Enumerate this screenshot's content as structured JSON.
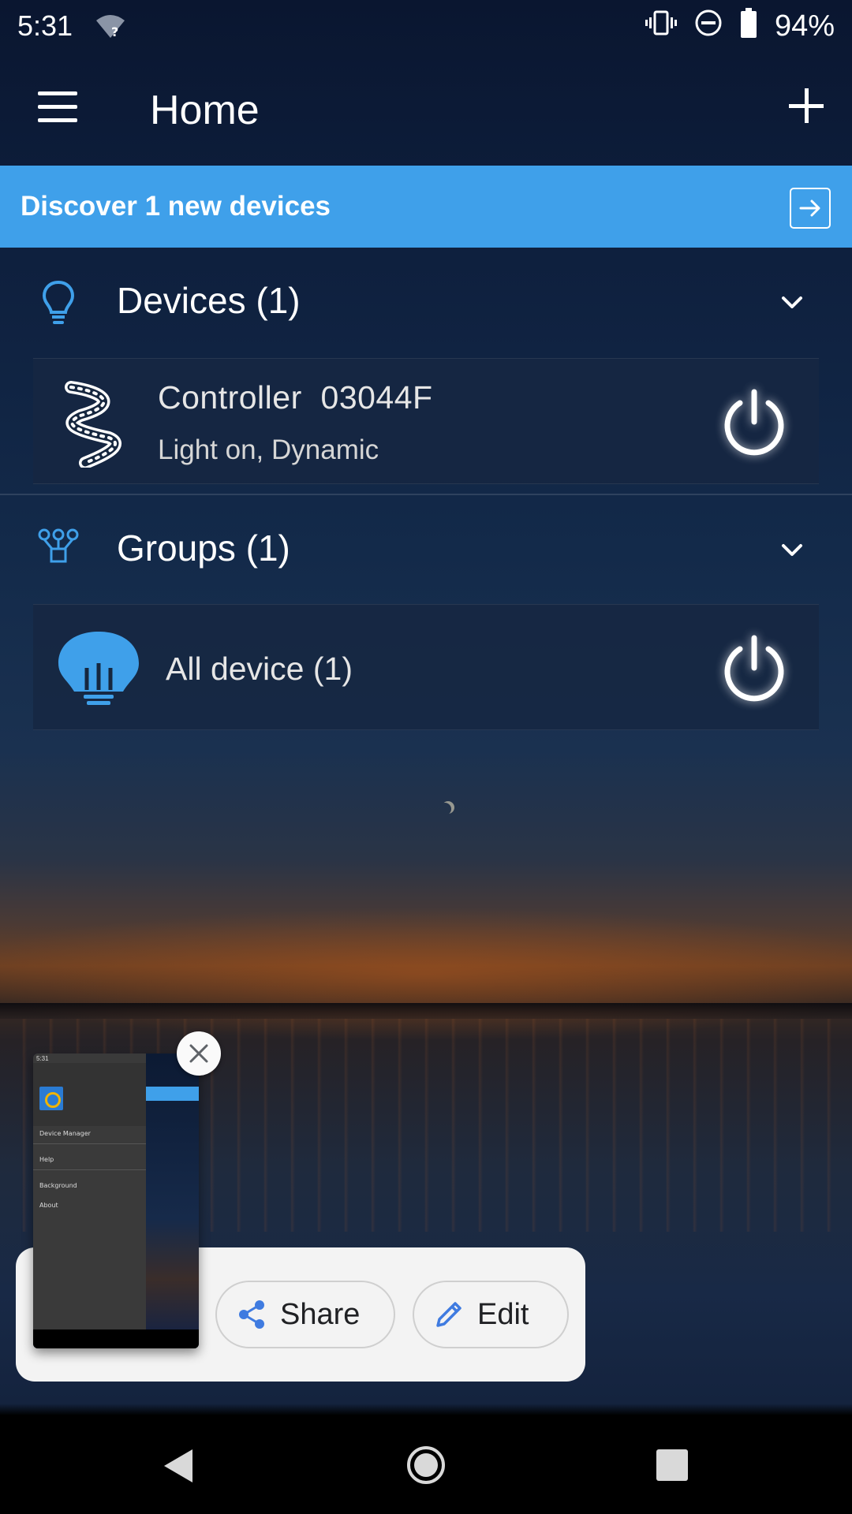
{
  "status_bar": {
    "time": "5:31",
    "wifi_icon": "wifi-unknown-icon",
    "vibrate_icon": "vibrate-icon",
    "dnd_icon": "do-not-disturb-icon",
    "battery_icon": "battery-icon",
    "battery_percent": "94%"
  },
  "app_bar": {
    "title": "Home",
    "menu_icon": "hamburger-menu-icon",
    "add_icon": "plus-icon"
  },
  "banner": {
    "text": "Discover 1 new devices",
    "color": "#3fa0ea",
    "icon": "arrow-right-box-icon"
  },
  "devices_section": {
    "label": "Devices (1)",
    "icon": "lightbulb-outline-icon",
    "items": [
      {
        "name": "Controller  03044F",
        "status": "Light on, Dynamic",
        "icon": "led-strip-icon",
        "power_icon": "power-icon"
      }
    ]
  },
  "groups_section": {
    "label": "Groups (1)",
    "icon": "group-tree-icon",
    "items": [
      {
        "name": "All device (1)",
        "icon": "lightbulb-filled-icon",
        "power_icon": "power-icon"
      }
    ]
  },
  "screenshot_preview": {
    "share_label": "Share",
    "edit_label": "Edit",
    "thumbnail": {
      "status_time": "5:31",
      "menu_items": [
        "Device Manager",
        "Help",
        "Background",
        "About"
      ]
    }
  },
  "nav_bar": {
    "back_icon": "back-triangle-icon",
    "home_icon": "home-circle-icon",
    "recents_icon": "recents-square-icon"
  }
}
